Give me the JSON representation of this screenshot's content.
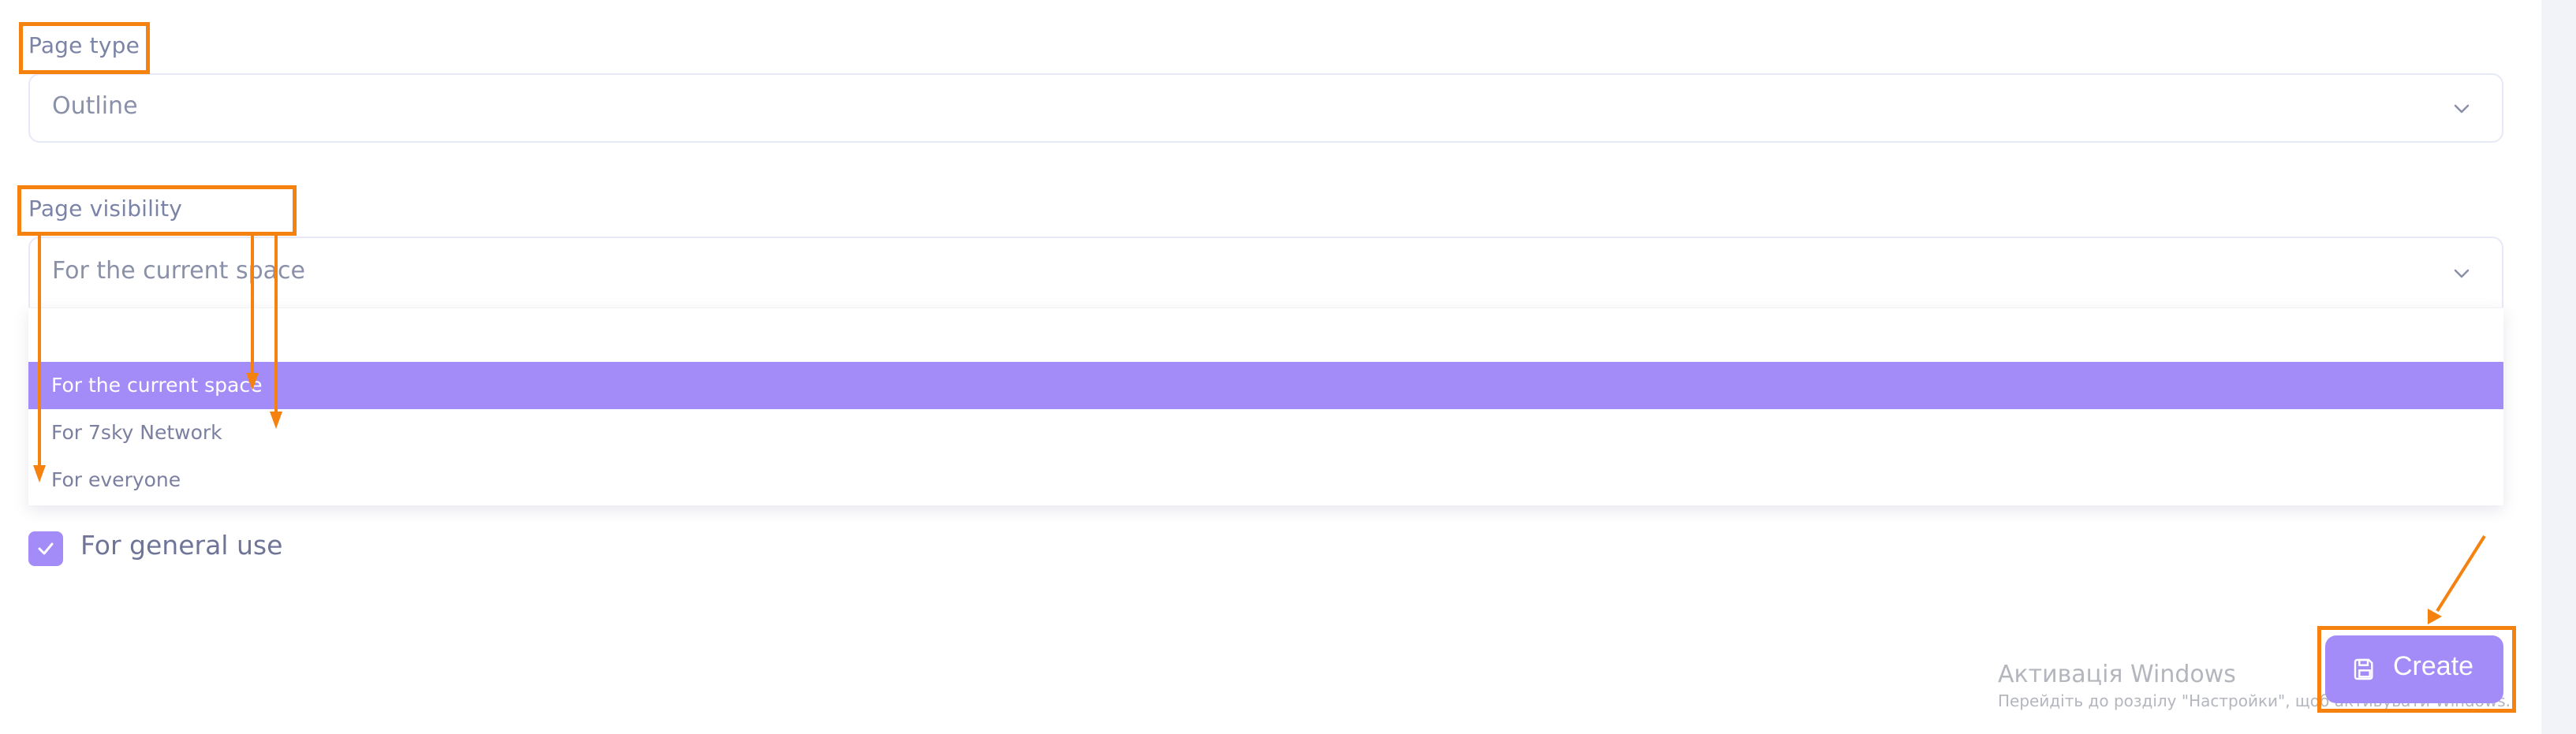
{
  "form": {
    "page_type": {
      "label": "Page type",
      "value": "Outline",
      "chevron_icon": "chevron-down-icon"
    },
    "page_visibility": {
      "label": "Page visibility",
      "value": "For the current space",
      "chevron_icon": "chevron-down-icon",
      "dropdown": {
        "search_value": "",
        "options": [
          {
            "label": "For the current space",
            "selected": true
          },
          {
            "label": "For 7sky Network",
            "selected": false
          },
          {
            "label": "For everyone",
            "selected": false
          }
        ]
      }
    },
    "general_use": {
      "label": "For general use",
      "checked": true
    },
    "create_button": {
      "label": "Create",
      "icon": "save-icon"
    }
  },
  "watermark": {
    "title": "Активація Windows",
    "subtitle": "Перейдіть до розділу \"Настройки\", щоб активувати Windows."
  },
  "colors": {
    "accent": "#a48cf8",
    "annotation": "#f5820e",
    "label_text": "#7b83a6",
    "border": "#e8e9f8"
  }
}
